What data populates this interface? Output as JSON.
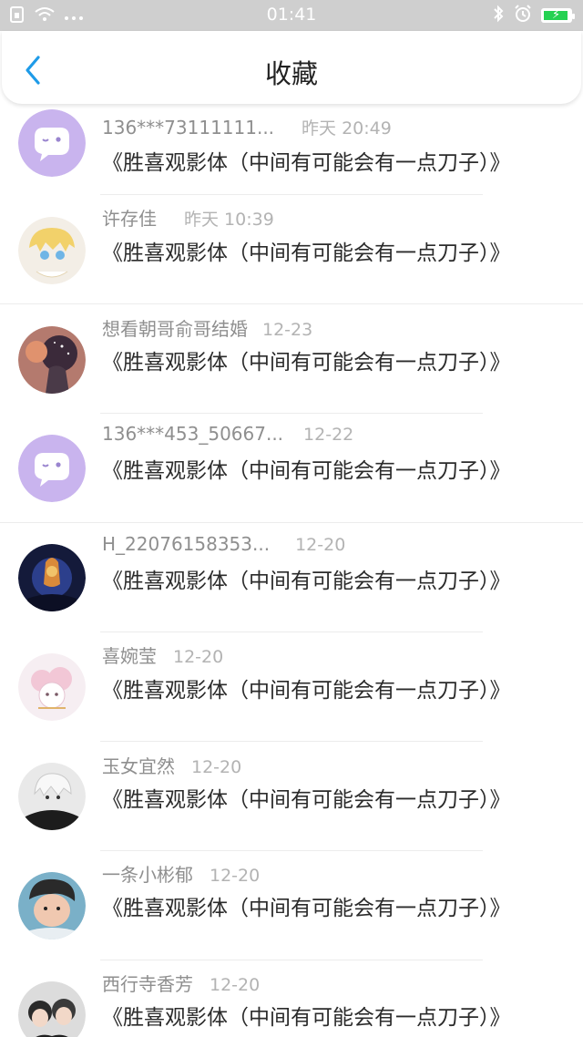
{
  "status_bar": {
    "time": "01:41"
  },
  "header": {
    "title": "收藏"
  },
  "colors": {
    "status_bar_bg": "#cfcfcf",
    "battery_green": "#25d152",
    "accent_blue": "#1e9be8",
    "default_avatar": "#c9b4ee"
  },
  "items": [
    {
      "name": "136***73111111...",
      "time": "昨天 20:49",
      "content": "《胜喜观影体（中间有可能会有一点刀子）》",
      "avatar": "default-chat-avatar"
    },
    {
      "name": "许存佳",
      "time": "昨天 10:39",
      "content": "《胜喜观影体（中间有可能会有一点刀子）》",
      "avatar": "anime-blonde-avatar"
    },
    {
      "name": "想看朝哥俞哥结婚",
      "time": "12-23",
      "content": "《胜喜观影体（中间有可能会有一点刀子）》",
      "avatar": "starry-photo-avatar"
    },
    {
      "name": "136***453_50667...",
      "time": "12-22",
      "content": "《胜喜观影体（中间有可能会有一点刀子）》",
      "avatar": "default-chat-avatar"
    },
    {
      "name": "H_22076158353...",
      "time": "12-20",
      "content": "《胜喜观影体（中间有可能会有一点刀子）》",
      "avatar": "dark-night-avatar"
    },
    {
      "name": "喜婉莹",
      "time": "12-20",
      "content": "《胜喜观影体（中间有可能会有一点刀子）》",
      "avatar": "pink-sheep-avatar"
    },
    {
      "name": "玉女宜然",
      "time": "12-20",
      "content": "《胜喜观影体（中间有可能会有一点刀子）》",
      "avatar": "white-hair-avatar"
    },
    {
      "name": "一条小彬郁",
      "time": "12-20",
      "content": "《胜喜观影体（中间有可能会有一点刀子）》",
      "avatar": "boy-photo-avatar"
    },
    {
      "name": "西行寺香芳",
      "time": "12-20",
      "content": "《胜喜观影体（中间有可能会有一点刀子）》",
      "avatar": "two-people-avatar"
    }
  ]
}
